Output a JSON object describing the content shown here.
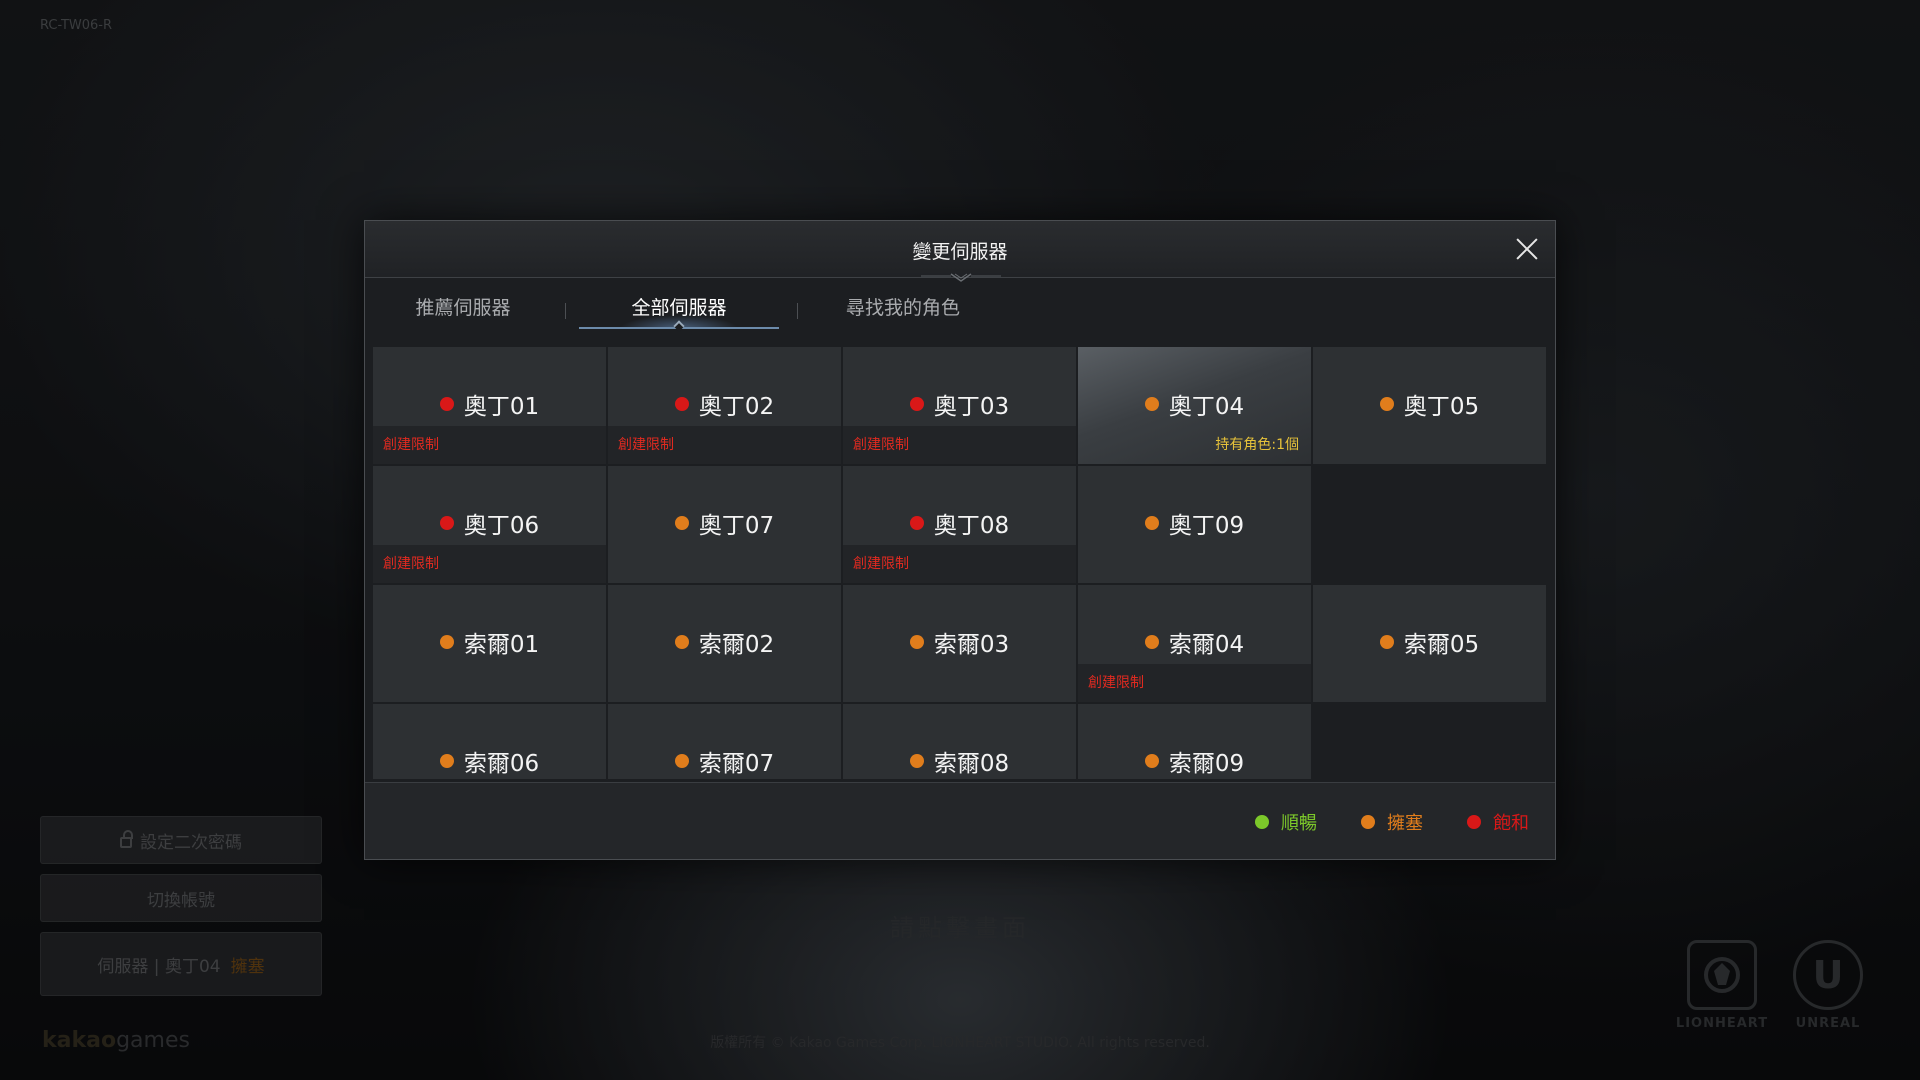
{
  "background": {
    "top_left_text": "RC-TW06-R",
    "side_buttons": {
      "second_password_label": "設定二次密碼",
      "switch_account_label": "切換帳號",
      "server_label": "伺服器 | 奧丁04",
      "server_status": "擁塞"
    },
    "start_text": "請點擊畫面",
    "copyright": "版權所有 © Kakao Games Corp. LIONHEART STUDIO. All rights reserved.",
    "publisher_logo": {
      "main": "kakao",
      "suffix": "games"
    },
    "developer_logo": {
      "caption": "LIONHEART"
    },
    "engine_logo": {
      "mark": "U",
      "caption": "UNREAL"
    }
  },
  "dialog": {
    "title": "變更伺服器",
    "tabs": [
      {
        "label": "推薦伺服器"
      },
      {
        "label": "全部伺服器"
      },
      {
        "label": "尋找我的角色"
      }
    ],
    "active_tab_index": 1,
    "status_colors": {
      "smooth": "#7cc82a",
      "busy": "#e07d1c",
      "full": "#d91818"
    },
    "note_colors": {
      "restricted": "#e02a20",
      "owned": "#e6c23a"
    },
    "servers": [
      {
        "name": "奧丁01",
        "status": "full",
        "note": "創建限制",
        "note_type": "restricted"
      },
      {
        "name": "奧丁02",
        "status": "full",
        "note": "創建限制",
        "note_type": "restricted"
      },
      {
        "name": "奧丁03",
        "status": "full",
        "note": "創建限制",
        "note_type": "restricted"
      },
      {
        "name": "奧丁04",
        "status": "busy",
        "note": "持有角色:1個",
        "note_type": "owned",
        "selected": true
      },
      {
        "name": "奧丁05",
        "status": "busy"
      },
      {
        "name": "奧丁06",
        "status": "full",
        "note": "創建限制",
        "note_type": "restricted"
      },
      {
        "name": "奧丁07",
        "status": "busy"
      },
      {
        "name": "奧丁08",
        "status": "full",
        "note": "創建限制",
        "note_type": "restricted"
      },
      {
        "name": "奧丁09",
        "status": "busy"
      },
      {
        "empty": true
      },
      {
        "name": "索爾01",
        "status": "busy"
      },
      {
        "name": "索爾02",
        "status": "busy"
      },
      {
        "name": "索爾03",
        "status": "busy"
      },
      {
        "name": "索爾04",
        "status": "busy",
        "note": "創建限制",
        "note_type": "restricted"
      },
      {
        "name": "索爾05",
        "status": "busy"
      },
      {
        "name": "索爾06",
        "status": "busy"
      },
      {
        "name": "索爾07",
        "status": "busy"
      },
      {
        "name": "索爾08",
        "status": "busy"
      },
      {
        "name": "索爾09",
        "status": "busy"
      },
      {
        "empty": true
      }
    ],
    "legend": [
      {
        "status": "smooth",
        "label": "順暢"
      },
      {
        "status": "busy",
        "label": "擁塞"
      },
      {
        "status": "full",
        "label": "飽和"
      }
    ]
  }
}
